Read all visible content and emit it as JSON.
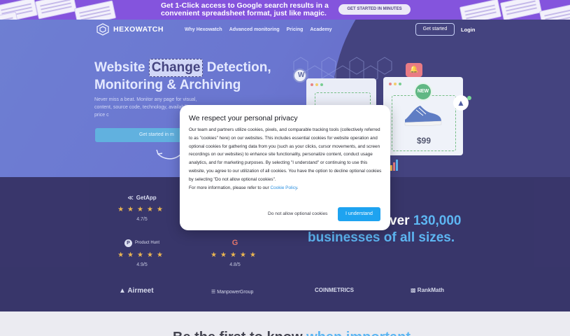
{
  "promo": {
    "text": "Get 1-Click access to Google search results in a convenient spreadsheet format, just like magic.",
    "cta": "GET STARTED IN MINUTES"
  },
  "nav": {
    "brand": "HEXOWATCH",
    "links": [
      "Why Hexowatch",
      "Advanced monitoring",
      "Pricing",
      "Academy"
    ],
    "get_started": "Get started",
    "login": "Login"
  },
  "hero": {
    "title_pre": "Website ",
    "title_highlight": "Change",
    "title_post": " Detection,",
    "title_line2": "Monitoring & Archiving",
    "subtitle": "Never miss a beat. Monitor any page for visual, content, source code, technology, availability, or price c",
    "cta": "Get started in m",
    "product_badge": "NEW",
    "product_price": "$99"
  },
  "reviews": [
    {
      "brand": "GetApp",
      "stars": "★★★★★",
      "score": "4.7/5"
    },
    {
      "brand": "Product Hunt",
      "stars": "★★★★★",
      "score": "4.9/5"
    },
    {
      "brand": "G",
      "stars": "★★★★★",
      "score": "4.8/5"
    }
  ],
  "stats": {
    "line1_fragment": "ver ",
    "number": "130,000",
    "line2": "businesses of all sizes."
  },
  "clients": [
    "Airmeet",
    "ManpowerGroup",
    "COINMETRICS",
    "RankMath"
  ],
  "bottom": {
    "headline_start": "Be the first to know ",
    "headline_blue": "when important"
  },
  "cookie_modal": {
    "title": "We respect your personal privacy",
    "body": "Our team and partners utilize cookies, pixels, and comparable tracking tools (collectively referred to as \"cookies\" here) on our websites. This includes essential cookies for website operation and optional cookies for gathering data from you (such as your clicks, cursor movements, and screen recordings on our websites) to enhance site functionality, personalize content, conduct usage analytics, and for marketing purposes. By selecting \"I understand\" or continuing to use this website, you agree to our utilization of all cookies. You have the option to decline optional cookies by selecting \"Do not allow optional cookies\".",
    "more_info": "For more information, please refer to our ",
    "policy_link": "Cookie Policy",
    "policy_after": ".",
    "decline": "Do not allow optional cookies",
    "accept": "I understand"
  }
}
